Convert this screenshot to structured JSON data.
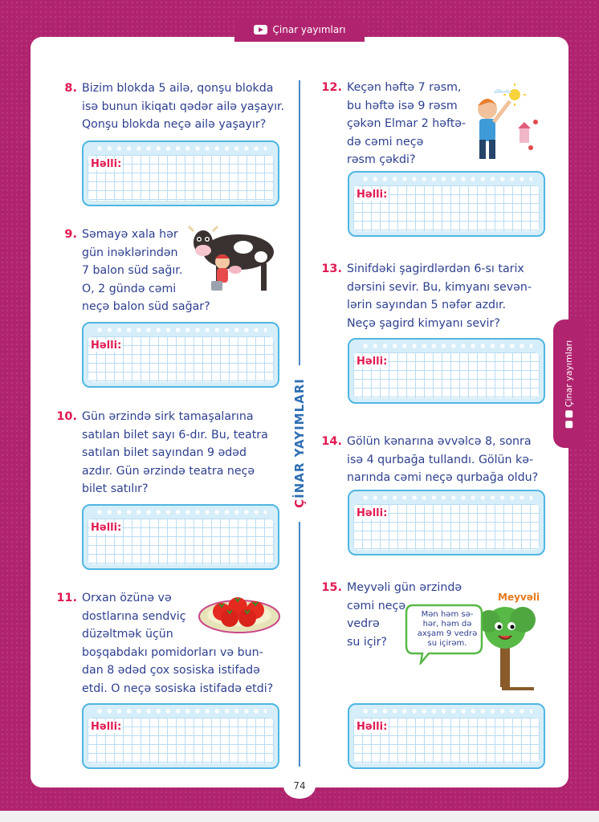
{
  "header": {
    "brand": "Çinar yayımları"
  },
  "side_tab": {
    "brand": "Çinar yayımları"
  },
  "divider": {
    "brand_first": "Ç",
    "brand_rest": "İNAR YAYIMLARI"
  },
  "answer_label": "Həlli:",
  "problems": [
    {
      "number": "8.",
      "lines": [
        "Bizim blokda 5 ailə, qonşu blokda",
        "isə bunun ikiqatı qədər ailə yaşayır.",
        "Qonşu blokda neçə ailə yaşayır?"
      ]
    },
    {
      "number": "9.",
      "lines": [
        "Səmayə xala hər",
        "gün inəklərindən",
        "7 balon süd sağır.",
        "O, 2 gündə cəmi",
        "neçə balon süd sağar?"
      ]
    },
    {
      "number": "10.",
      "lines": [
        "Gün ərzində sirk tamaşalarına",
        "satılan bilet sayı 6-dır. Bu, teatra",
        "satılan bilet sayından 9 ədəd",
        "azdır. Gün ərzində teatra neçə",
        "bilet satılır?"
      ]
    },
    {
      "number": "11.",
      "lines": [
        "Orxan özünə və",
        "dostlarına sendviç",
        "düzəltmək üçün",
        "boşqabdakı pomidorları və bun-",
        "dan 8 ədəd çox sosiska istifadə",
        "etdi. O neçə sosiska istifadə etdi?"
      ]
    },
    {
      "number": "12.",
      "lines": [
        "Keçən həftə 7 rəsm,",
        "bu həftə isə 9 rəsm",
        "çəkən Elmar 2 həftə-",
        "də cəmi neçə",
        "rəsm çəkdi?"
      ]
    },
    {
      "number": "13.",
      "lines": [
        "Sinifdəki şagirdlərdən 6-sı tarix",
        "dərsini sevir. Bu, kimyanı sevən-",
        "lərin sayından 5 nəfər azdır.",
        "Neçə şagird kimyanı sevir?"
      ]
    },
    {
      "number": "14.",
      "lines": [
        "Gölün kənarına əvvəlcə 8, sonra",
        "isə 4 qurbağa tullandı. Gölün kə-",
        "narında cəmi neçə qurbağa oldu?"
      ]
    },
    {
      "number": "15.",
      "lines": [
        "Meyvəli gün ərzində",
        "cəmi neçə",
        "vedrə",
        "su içir?"
      ]
    }
  ],
  "tree": {
    "name": "Meyvəli",
    "speech": [
      "Mən həm sə-",
      "hər, həm də",
      "axşam 9 vedrə",
      "su içirəm."
    ]
  },
  "page_number": "74",
  "colors": {
    "magenta": "#b0246f",
    "navy_text": "#2d3f8e",
    "red_number": "#e01b52",
    "box_blue": "#4fb6e3"
  }
}
